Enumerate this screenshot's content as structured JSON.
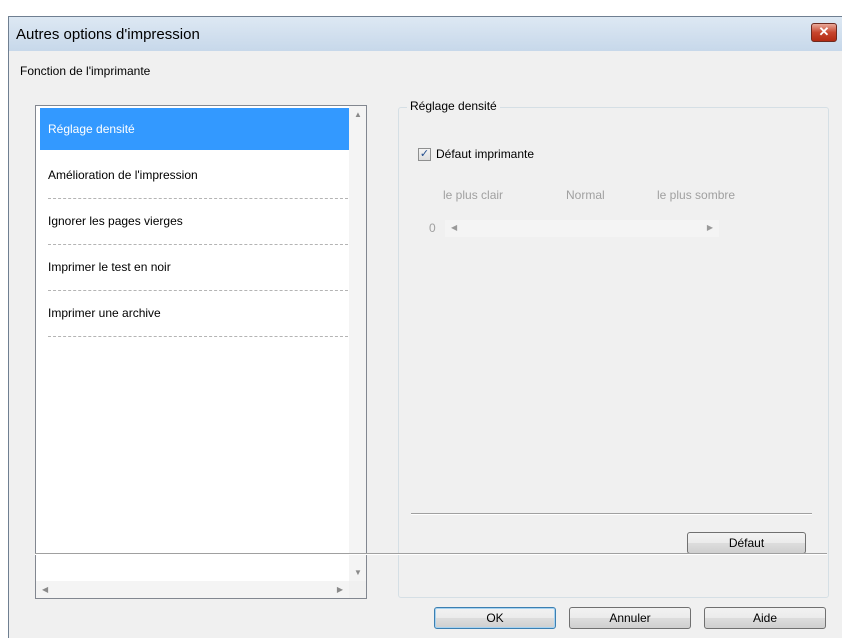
{
  "window": {
    "title": "Autres options d'impression",
    "close_glyph": "✕"
  },
  "function_group": {
    "label": "Fonction de l'imprimante",
    "items": [
      {
        "label": "Réglage densité",
        "selected": true
      },
      {
        "label": "Amélioration de l'impression",
        "selected": false
      },
      {
        "label": "Ignorer les pages vierges",
        "selected": false
      },
      {
        "label": "Imprimer le test en noir",
        "selected": false
      },
      {
        "label": "Imprimer une archive",
        "selected": false
      }
    ]
  },
  "density_group": {
    "title": "Réglage densité",
    "default_checkbox": {
      "label": "Défaut imprimante",
      "checked": true,
      "check_glyph": "✓"
    },
    "scale_labels": {
      "light": "le plus clair",
      "normal": "Normal",
      "dark": "le plus sombre"
    },
    "value": "0",
    "default_button": "Défaut"
  },
  "buttons": {
    "ok": "OK",
    "cancel": "Annuler",
    "help": "Aide"
  },
  "colors": {
    "selection": "#3399ff",
    "close": "#c7452d"
  }
}
